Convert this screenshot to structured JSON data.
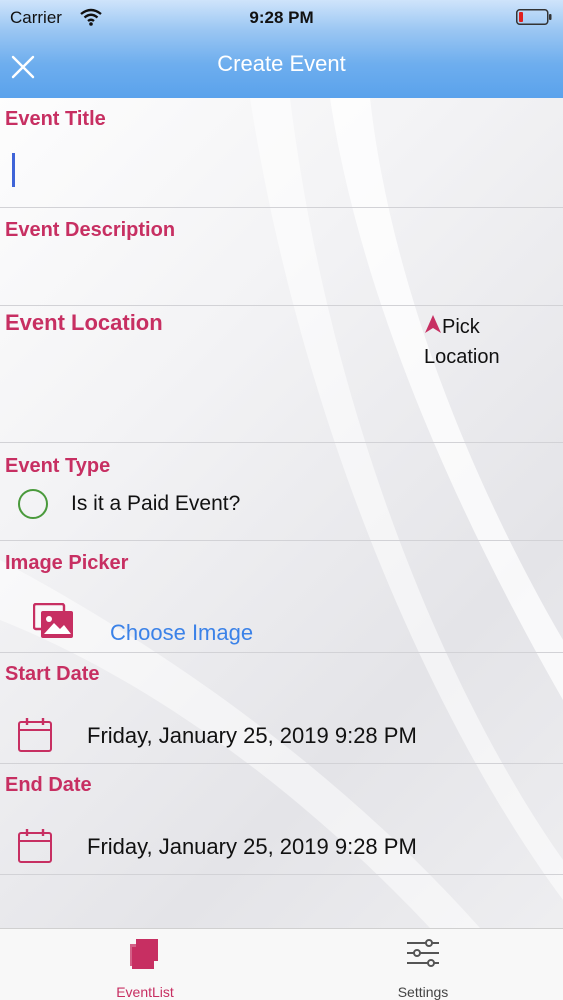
{
  "status": {
    "carrier": "Carrier",
    "time": "9:28 PM"
  },
  "nav": {
    "title": "Create Event"
  },
  "form": {
    "event_title_label": "Event Title",
    "event_title_value": "",
    "event_description_label": "Event Description",
    "event_location_label": "Event Location",
    "pick_location_label": "Pick Location",
    "event_type_label": "Event Type",
    "paid_event_label": "Is it a Paid Event?",
    "paid_event_checked": false,
    "image_picker_label": "Image Picker",
    "choose_image_label": "Choose Image",
    "start_date_label": "Start Date",
    "start_date_value": "Friday, January 25, 2019 9:28 PM",
    "end_date_label": "End Date",
    "end_date_value": "Friday, January 25, 2019 9:28 PM"
  },
  "tabs": [
    {
      "label": "EventList",
      "icon": "stack-icon",
      "active": true
    },
    {
      "label": "Settings",
      "icon": "sliders-icon",
      "active": false
    }
  ],
  "colors": {
    "accent": "#c72f62",
    "link": "#3b82e8",
    "nav_blue": "#5aa2ec",
    "radio_green": "#4a9a3c"
  }
}
